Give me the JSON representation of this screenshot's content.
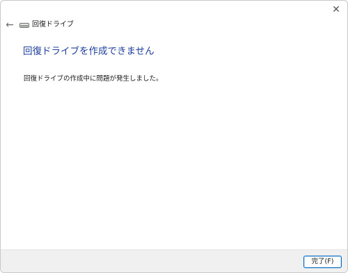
{
  "window": {
    "title": "回復ドライブ",
    "close_glyph": "✕",
    "back_glyph": "←",
    "accent_color": "#1f3f9e",
    "icons": {
      "back": "back-arrow-icon",
      "drive": "drive-icon",
      "close": "close-icon"
    }
  },
  "content": {
    "heading": "回復ドライブを作成できません",
    "message": "回復ドライブの作成中に問題が発生しました。"
  },
  "footer": {
    "finish_label": "完了(F)"
  }
}
